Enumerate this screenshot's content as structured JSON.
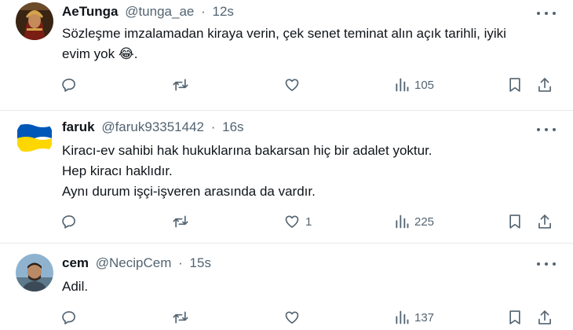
{
  "tweets": [
    {
      "name": "AeTunga",
      "handle": "@tunga_ae",
      "time": "12s",
      "lines": [
        "Sözleşme imzalamadan kiraya verin, çek senet teminat alın açık tarihli, iyiki",
        "evim yok"
      ],
      "emoji": "😂",
      "trailing": ".",
      "reply_count": "",
      "retweet_count": "",
      "like_count": "",
      "view_count": "105"
    },
    {
      "name": "faruk",
      "handle": "@faruk93351442",
      "time": "16s",
      "lines": [
        "Kiracı-ev sahibi hak hukuklarına bakarsan hiç bir adalet yoktur.",
        "Hep kiracı haklıdır.",
        "Aynı durum işçi-işveren arasında da vardır."
      ],
      "reply_count": "",
      "retweet_count": "",
      "like_count": "1",
      "view_count": "225"
    },
    {
      "name": "cem",
      "handle": "@NecipCem",
      "time": "15s",
      "lines": [
        "Adil."
      ],
      "reply_count": "",
      "retweet_count": "",
      "like_count": "",
      "view_count": "137"
    }
  ],
  "separator": "·",
  "icons": {
    "reply": "reply-icon",
    "retweet": "retweet-icon",
    "like": "heart-icon",
    "views": "views-icon",
    "bookmark": "bookmark-icon",
    "share": "share-icon",
    "more": "more-icon"
  },
  "colors": {
    "text": "#0f1419",
    "secondary": "#536471",
    "divider": "#e6e9eb",
    "ukraine_blue": "#0057b7",
    "ukraine_yellow": "#ffd700"
  }
}
